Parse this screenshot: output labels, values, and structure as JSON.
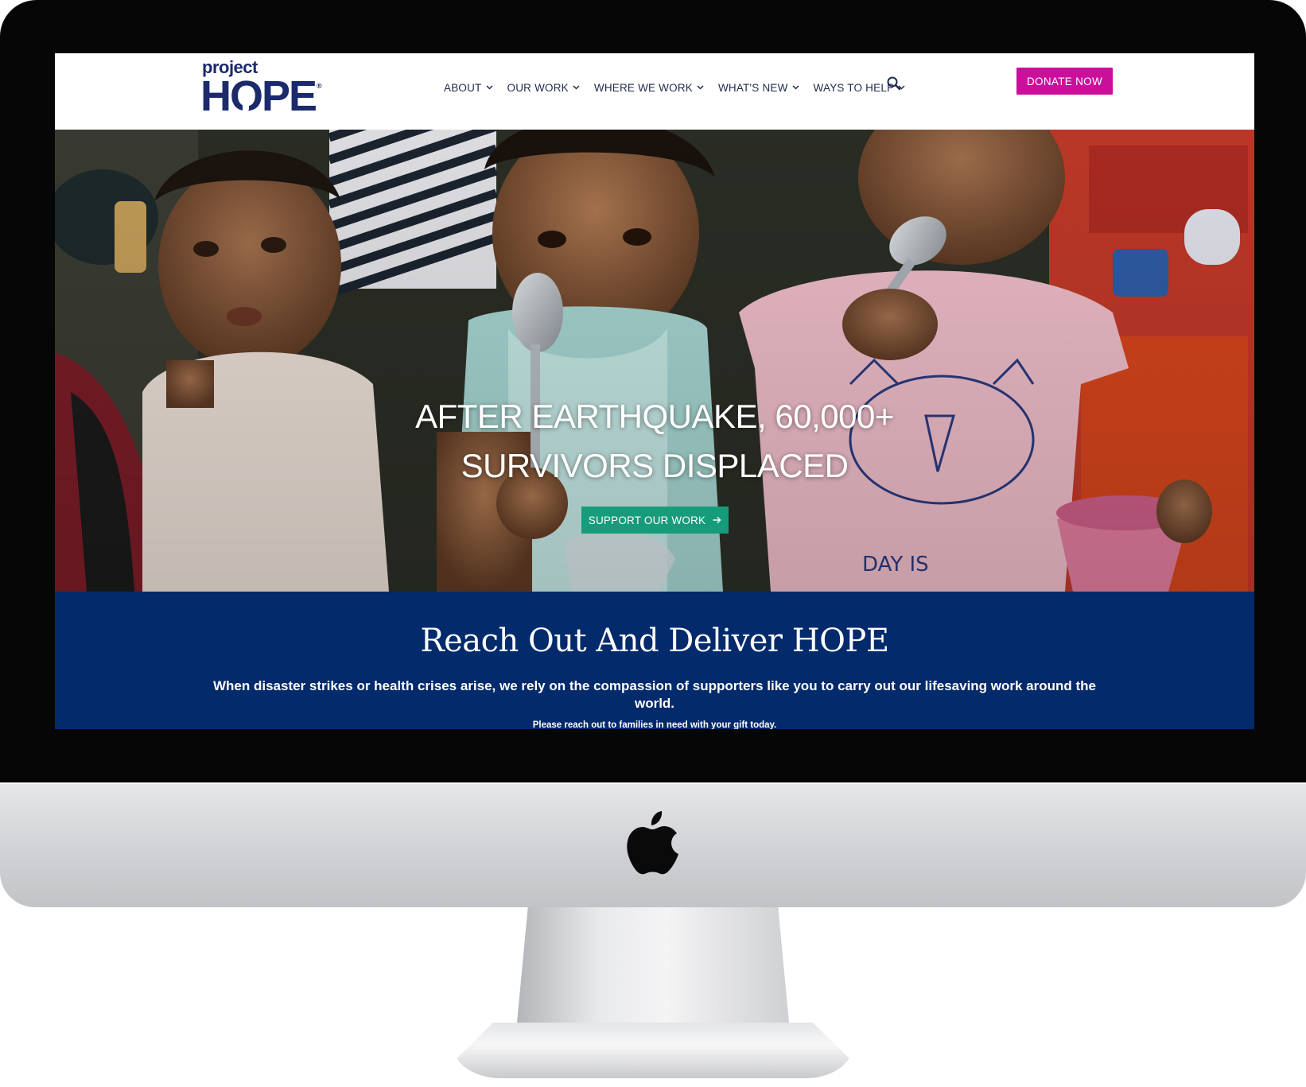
{
  "logo": {
    "line1": "project",
    "line2": "HOPE",
    "trademark": "®"
  },
  "nav": {
    "items": [
      {
        "label": "ABOUT"
      },
      {
        "label": "OUR WORK"
      },
      {
        "label": "WHERE WE WORK"
      },
      {
        "label": "WHAT'S NEW"
      },
      {
        "label": "WAYS TO HELP"
      }
    ],
    "search_icon": "search-icon",
    "donate_label": "DONATE NOW"
  },
  "hero": {
    "title_line1": "AFTER EARTHQUAKE, 60,000+",
    "title_line2": "SURVIVORS DISPLACED",
    "cta_label": "SUPPORT OUR WORK"
  },
  "band": {
    "title": "Reach Out And Deliver HOPE",
    "text": "When disaster strikes or health crises arise, we rely on the compassion of supporters like you to carry out our lifesaving work around the world.",
    "cta_text": "Please reach out to families in need with your gift today."
  },
  "colors": {
    "brand_navy": "#1b2a6b",
    "donate_magenta": "#cc0f9b",
    "cta_green": "#169b7b",
    "band_blue": "#032a6b",
    "bezel": "#060606"
  }
}
